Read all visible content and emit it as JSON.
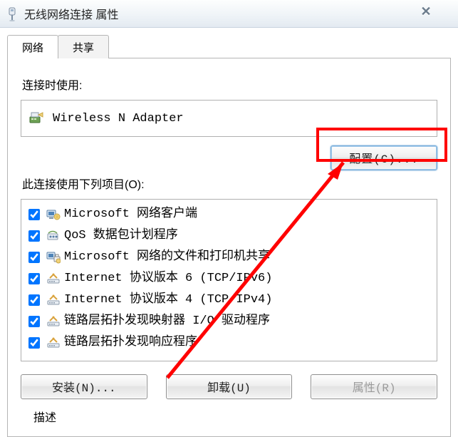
{
  "window": {
    "title": "无线网络连接 属性",
    "close_glyph": "✕"
  },
  "tabs": {
    "network": "网络",
    "sharing": "共享"
  },
  "labels": {
    "connect_using": "连接时使用:",
    "this_connection_uses": "此连接使用下列项目(O):",
    "description_cut": "描述"
  },
  "adapter": {
    "name": "Wireless N Adapter"
  },
  "buttons": {
    "configure": "配置(C)...",
    "install": "安装(N)...",
    "uninstall": "卸载(U)",
    "properties": "属性(R)"
  },
  "items": [
    {
      "checked": true,
      "icon": "client",
      "label": "Microsoft 网络客户端"
    },
    {
      "checked": true,
      "icon": "qos",
      "label": "QoS 数据包计划程序"
    },
    {
      "checked": true,
      "icon": "fileprint",
      "label": "Microsoft 网络的文件和打印机共享"
    },
    {
      "checked": true,
      "icon": "protocol",
      "label": "Internet 协议版本 6 (TCP/IPv6)"
    },
    {
      "checked": true,
      "icon": "protocol",
      "label": "Internet 协议版本 4 (TCP/IPv4)"
    },
    {
      "checked": true,
      "icon": "protocol",
      "label": "链路层拓扑发现映射器 I/O 驱动程序"
    },
    {
      "checked": true,
      "icon": "protocol",
      "label": "链路层拓扑发现响应程序"
    }
  ]
}
